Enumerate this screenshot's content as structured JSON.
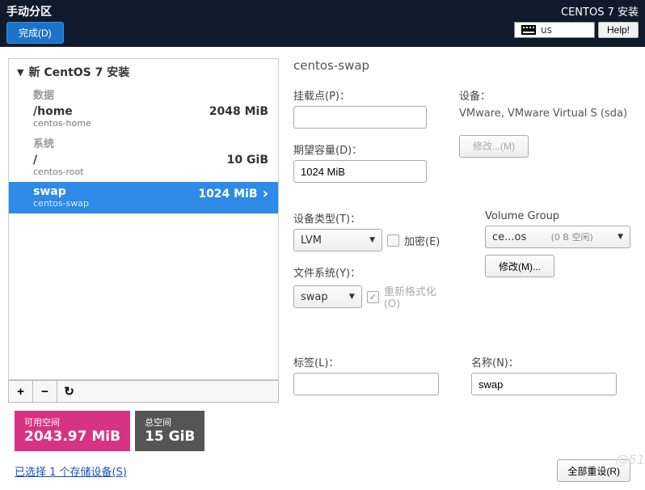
{
  "header": {
    "title": "手动分区",
    "done": "完成(D)",
    "install_title": "CENTOS 7 安装",
    "keyboard": "us",
    "help": "Help!"
  },
  "tree": {
    "root_label": "新 CentOS 7 安装",
    "section_data": "数据",
    "section_system": "系统",
    "items": [
      {
        "path": "/home",
        "name": "centos-home",
        "size": "2048 MiB"
      },
      {
        "path": "/",
        "name": "centos-root",
        "size": "10 GiB"
      },
      {
        "path": "swap",
        "name": "centos-swap",
        "size": "1024 MiB"
      }
    ]
  },
  "toolbar": {
    "add": "+",
    "remove": "−",
    "reload": "↻"
  },
  "detail": {
    "title": "centos-swap",
    "mount_label": "挂载点(P)：",
    "mount_value": "",
    "capacity_label": "期望容量(D)：",
    "capacity_value": "1024 MiB",
    "device_label": "设备：",
    "device_text": "VMware, VMware Virtual S (sda)",
    "modify_device": "修改...(M)",
    "dtype_label": "设备类型(T)：",
    "dtype_value": "LVM",
    "encrypt_label": "加密(E)",
    "vg_label": "Volume Group",
    "vg_value": "ce...os",
    "vg_free": "(0 B 空闲)",
    "modify_vg": "修改(M)...",
    "fs_label": "文件系统(Y)：",
    "fs_value": "swap",
    "reformat_label": "重新格式化(O)",
    "tag_label": "标签(L)：",
    "tag_value": "",
    "name_label": "名称(N)：",
    "name_value": "swap"
  },
  "footer": {
    "avail_label": "可用空间",
    "avail_value": "2043.97 MiB",
    "total_label": "总空间",
    "total_value": "15 GiB",
    "storage_link": "已选择 1 个存储设备(S)",
    "reset_all": "全部重设(R)",
    "watermark": "@51"
  }
}
